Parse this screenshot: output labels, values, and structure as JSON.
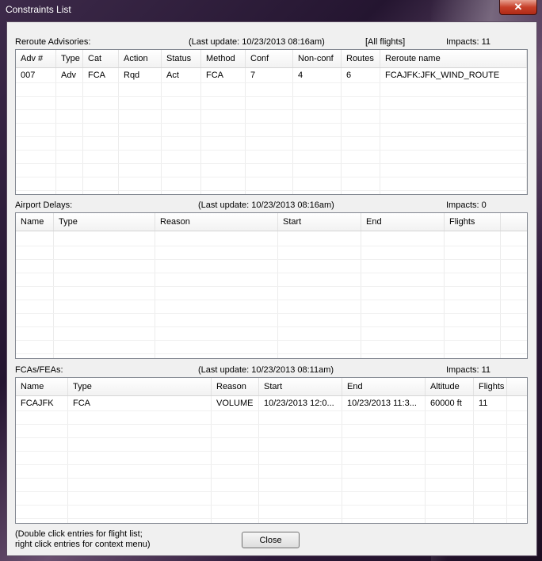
{
  "window": {
    "title": "Constraints List",
    "close_glyph": "✕"
  },
  "reroute": {
    "label": "Reroute Advisories:",
    "last_update": "(Last update: 10/23/2013 08:16am)",
    "scope": "[All flights]",
    "impacts": "Impacts: 11",
    "columns": [
      "Adv #",
      "Type",
      "Cat",
      "Action",
      "Status",
      "Method",
      "Conf",
      "Non-conf",
      "Routes",
      "Reroute name"
    ],
    "rows": [
      [
        "007",
        "Adv",
        "FCA",
        "Rqd",
        "Act",
        "FCA",
        "7",
        "4",
        "6",
        "FCAJFK:JFK_WIND_ROUTE"
      ]
    ]
  },
  "airport": {
    "label": "Airport Delays:",
    "last_update": "(Last update: 10/23/2013 08:16am)",
    "impacts": "Impacts: 0",
    "columns": [
      "Name",
      "Type",
      "Reason",
      "Start",
      "End",
      "Flights"
    ],
    "rows": []
  },
  "fca": {
    "label": "FCAs/FEAs:",
    "last_update": "(Last update: 10/23/2013 08:11am)",
    "impacts": "Impacts: 11",
    "columns": [
      "Name",
      "Type",
      "Reason",
      "Start",
      "End",
      "Altitude",
      "Flights"
    ],
    "rows": [
      [
        "FCAJFK",
        "FCA",
        "VOLUME",
        "10/23/2013 12:0...",
        "10/23/2013 11:3...",
        "60000 ft",
        "11"
      ]
    ]
  },
  "footer": {
    "hint_line1": "(Double click entries for flight list;",
    "hint_line2": "right click entries for context menu)",
    "close_label": "Close"
  }
}
